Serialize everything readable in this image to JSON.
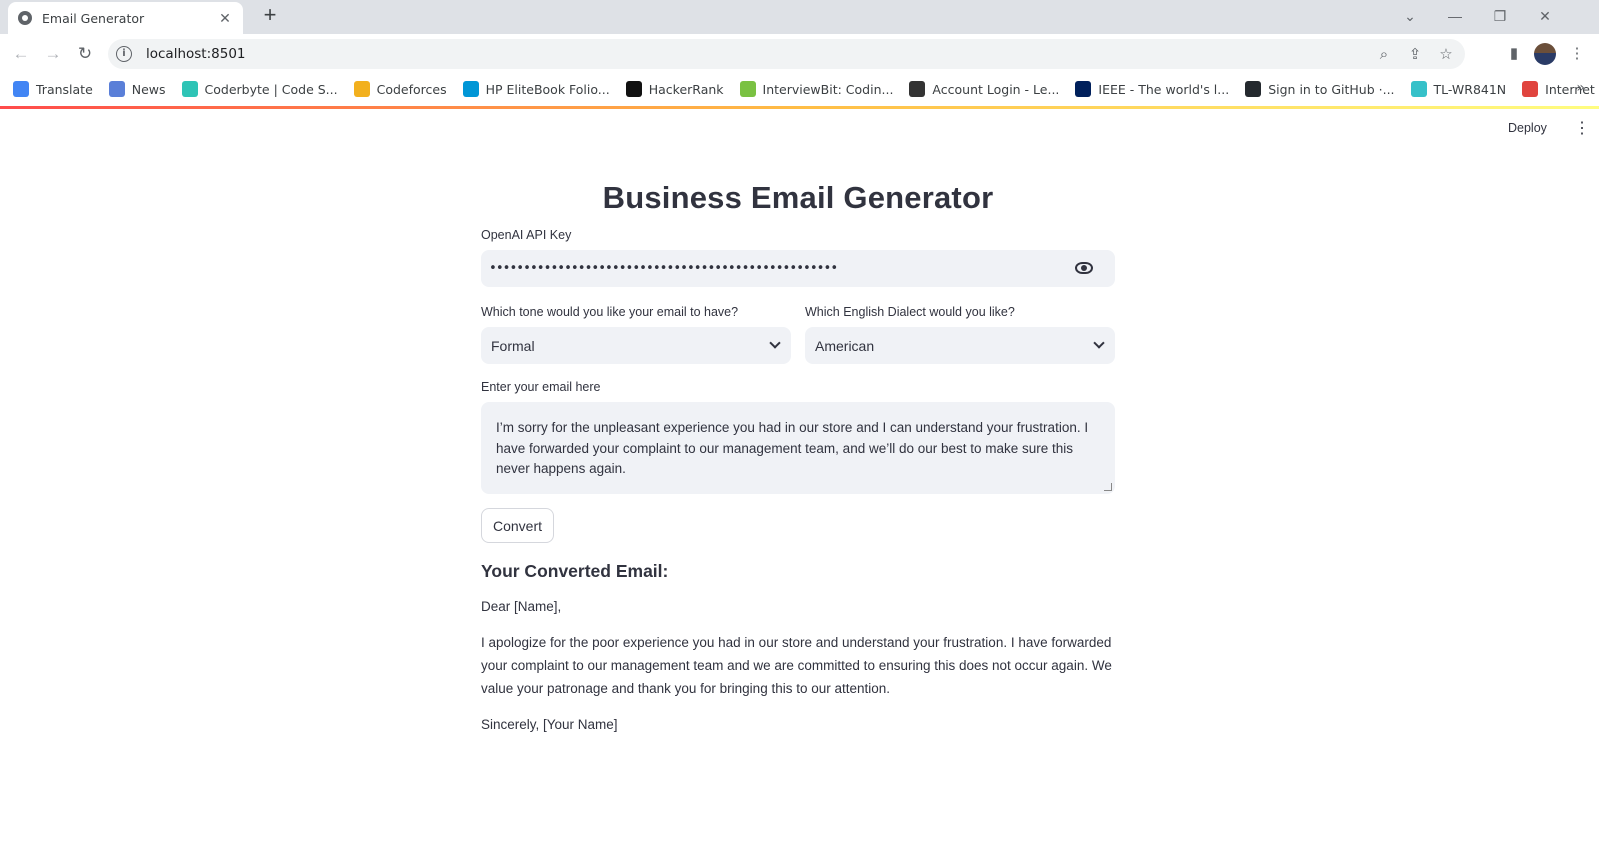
{
  "browser": {
    "tab_title": "Email Generator",
    "tab_close": "✕",
    "new_tab": "+",
    "url": "localhost:8501",
    "bookmarks": [
      {
        "label": "Translate",
        "color": "#4285f4"
      },
      {
        "label": "News",
        "color": "#5a7fd8"
      },
      {
        "label": "Coderbyte | Code S...",
        "color": "#2ec4b6"
      },
      {
        "label": "Codeforces",
        "color": "#f2b01e"
      },
      {
        "label": "HP EliteBook Folio...",
        "color": "#0096d6"
      },
      {
        "label": "HackerRank",
        "color": "#111111"
      },
      {
        "label": "InterviewBit: Codin...",
        "color": "#7ac142"
      },
      {
        "label": "Account Login - Le...",
        "color": "#333333"
      },
      {
        "label": "IEEE - The world's l...",
        "color": "#00205b"
      },
      {
        "label": "Sign in to GitHub ·...",
        "color": "#24292e"
      },
      {
        "label": "TL-WR841N",
        "color": "#36c1c9"
      },
      {
        "label": "Internet Speed Test...",
        "color": "#e0443e"
      }
    ],
    "bookmarks_more": "»"
  },
  "app": {
    "deploy_label": "Deploy",
    "title": "Business Email Generator",
    "api_key": {
      "label": "OpenAI API Key",
      "value": "•••••••••••••••••••••••••••••••••••••••••••••••••••"
    },
    "tone": {
      "label": "Which tone would you like your email to have?",
      "selected": "Formal"
    },
    "dialect": {
      "label": "Which English Dialect would you like?",
      "selected": "American"
    },
    "email_input": {
      "label": "Enter your email here",
      "value": "I’m sorry for the unpleasant experience you had in our store and I can understand your frustration. I have forwarded your complaint to our management team, and we’ll do our best to make sure this never happens again."
    },
    "convert_label": "Convert",
    "result": {
      "heading": "Your Converted Email:",
      "greeting": "Dear [Name],",
      "body": "I apologize for the poor experience you had in our store and understand your frustration. I have forwarded your complaint to our management team and we are committed to ensuring this does not occur again. We value your patronage and thank you for bringing this to our attention.",
      "closing": "Sincerely, [Your Name]"
    }
  }
}
